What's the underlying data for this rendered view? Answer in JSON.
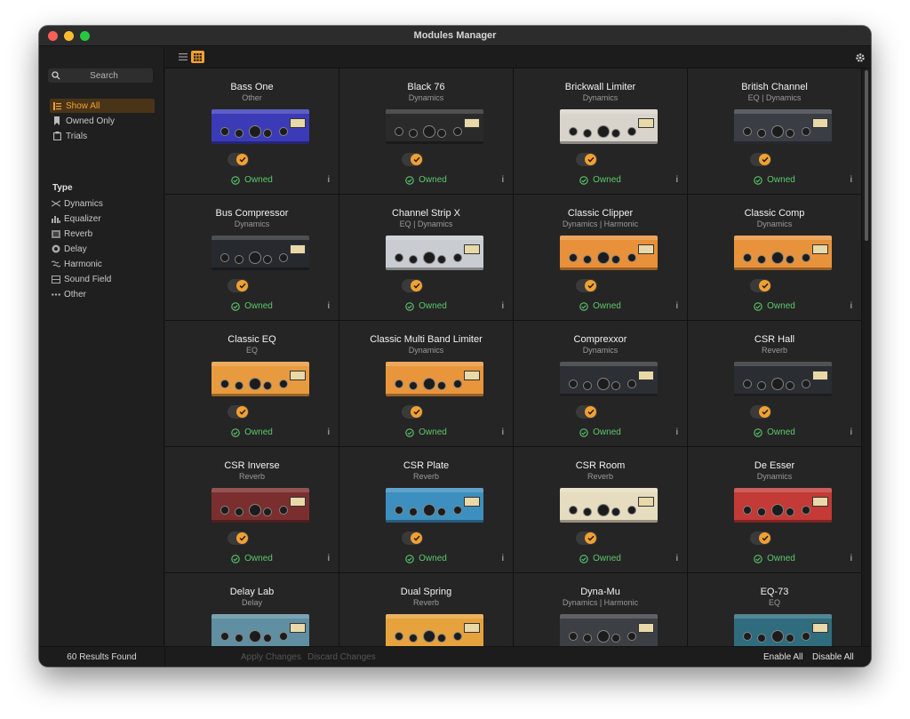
{
  "window": {
    "title": "Modules Manager"
  },
  "sidebar": {
    "search_placeholder": "Search",
    "filters": [
      {
        "label": "Show All",
        "icon": "list-icon",
        "active": true
      },
      {
        "label": "Owned Only",
        "icon": "bookmark-icon",
        "active": false
      },
      {
        "label": "Trials",
        "icon": "clipboard-icon",
        "active": false
      }
    ],
    "type_heading": "Type",
    "types": [
      {
        "label": "Dynamics",
        "icon": "dynamics-icon"
      },
      {
        "label": "Equalizer",
        "icon": "equalizer-icon"
      },
      {
        "label": "Reverb",
        "icon": "reverb-icon"
      },
      {
        "label": "Delay",
        "icon": "delay-icon"
      },
      {
        "label": "Harmonic",
        "icon": "harmonic-icon"
      },
      {
        "label": "Sound Field",
        "icon": "sound-field-icon"
      },
      {
        "label": "Other",
        "icon": "ellipsis-icon"
      }
    ]
  },
  "modules": [
    {
      "name": "Bass One",
      "category": "Other",
      "status": "Owned",
      "color": "#3b3bb8"
    },
    {
      "name": "Black 76",
      "category": "Dynamics",
      "status": "Owned",
      "color": "#2a2a2a"
    },
    {
      "name": "Brickwall Limiter",
      "category": "Dynamics",
      "status": "Owned",
      "color": "#d8d4cc"
    },
    {
      "name": "British Channel",
      "category": "EQ | Dynamics",
      "status": "Owned",
      "color": "#3a3e44"
    },
    {
      "name": "Bus Compressor",
      "category": "Dynamics",
      "status": "Owned",
      "color": "#26292d"
    },
    {
      "name": "Channel Strip X",
      "category": "EQ | Dynamics",
      "status": "Owned",
      "color": "#c9ccd0"
    },
    {
      "name": "Classic Clipper",
      "category": "Dynamics | Harmonic",
      "status": "Owned",
      "color": "#e8903a"
    },
    {
      "name": "Classic Comp",
      "category": "Dynamics",
      "status": "Owned",
      "color": "#e8933c"
    },
    {
      "name": "Classic EQ",
      "category": "EQ",
      "status": "Owned",
      "color": "#e89a3e"
    },
    {
      "name": "Classic Multi Band Limiter",
      "category": "Dynamics",
      "status": "Owned",
      "color": "#e8953c"
    },
    {
      "name": "Comprexxor",
      "category": "Dynamics",
      "status": "Owned",
      "color": "#2c2f33"
    },
    {
      "name": "CSR Hall",
      "category": "Reverb",
      "status": "Owned",
      "color": "#2a2d31"
    },
    {
      "name": "CSR Inverse",
      "category": "Reverb",
      "status": "Owned",
      "color": "#7a2f2e"
    },
    {
      "name": "CSR Plate",
      "category": "Reverb",
      "status": "Owned",
      "color": "#3d8fbf"
    },
    {
      "name": "CSR Room",
      "category": "Reverb",
      "status": "Owned",
      "color": "#e6dcc0"
    },
    {
      "name": "De Esser",
      "category": "Dynamics",
      "status": "Owned",
      "color": "#c33a36"
    },
    {
      "name": "Delay Lab",
      "category": "Delay",
      "status": "",
      "color": "#5f8fa0"
    },
    {
      "name": "Dual Spring",
      "category": "Reverb",
      "status": "",
      "color": "#e6a23c"
    },
    {
      "name": "Dyna-Mu",
      "category": "Dynamics | Harmonic",
      "status": "",
      "color": "#3c3f43"
    },
    {
      "name": "EQ-73",
      "category": "EQ",
      "status": "",
      "color": "#2f6d7e"
    }
  ],
  "footer": {
    "results": "60 Results Found",
    "apply": "Apply Changes",
    "discard": "Discard Changes",
    "enable_all": "Enable All",
    "disable_all": "Disable All"
  },
  "colors": {
    "accent": "#f0a134",
    "owned": "#5cc86c",
    "background": "#1e1e1e",
    "card": "#252525"
  }
}
